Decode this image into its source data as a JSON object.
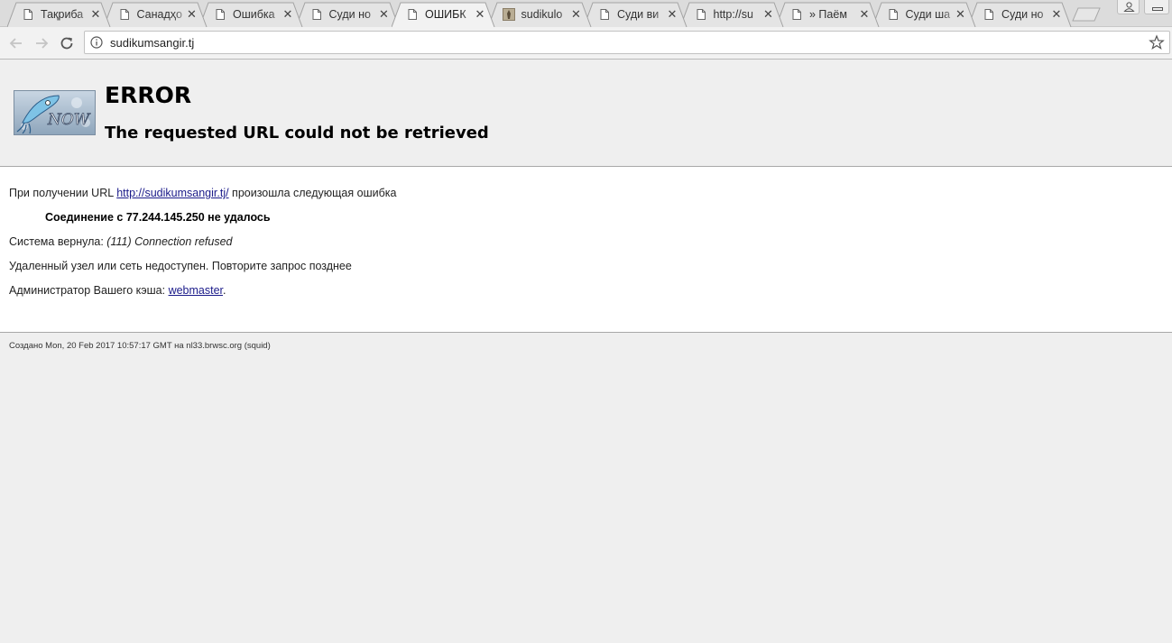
{
  "browser": {
    "tabs": [
      {
        "title": "Тақриба",
        "favicon": "page-icon"
      },
      {
        "title": "Санадҳо",
        "favicon": "page-icon"
      },
      {
        "title": "Ошибка",
        "favicon": "page-icon"
      },
      {
        "title": "Суди но",
        "favicon": "page-icon"
      },
      {
        "title": "ОШИБК",
        "favicon": "page-icon",
        "active": true
      },
      {
        "title": "sudikulo",
        "favicon": "site-image-icon"
      },
      {
        "title": "Суди ви",
        "favicon": "page-icon"
      },
      {
        "title": "http://su",
        "favicon": "page-icon"
      },
      {
        "title": "» Паём",
        "favicon": "page-icon"
      },
      {
        "title": "Суди ша",
        "favicon": "page-icon"
      },
      {
        "title": "Суди но",
        "favicon": "page-icon"
      }
    ],
    "close_glyph": "✕",
    "address": "sudikumsangir.tj"
  },
  "page": {
    "heading": "ERROR",
    "subheading": "The requested URL could not be retrieved",
    "url_prefix": "При получении URL ",
    "url_link": "http://sudikumsangir.tj/",
    "url_suffix": " произошла следующая ошибка",
    "error_detail": "Соединение с 77.244.145.250 не удалось",
    "system_prefix": "Система вернула: ",
    "system_value": "(111) Connection refused",
    "unreachable": "Удаленный узел или сеть недоступен. Повторите запрос позднее",
    "admin_prefix": "Администратор Вашего кэша: ",
    "admin_link": "webmaster",
    "admin_suffix": ".",
    "footer": "Создано Mon, 20 Feb 2017 10:57:17 GMT на nl33.brwsc.org (squid)"
  },
  "colors": {
    "link": "#1b1b8a",
    "page_bg": "#efefef"
  }
}
